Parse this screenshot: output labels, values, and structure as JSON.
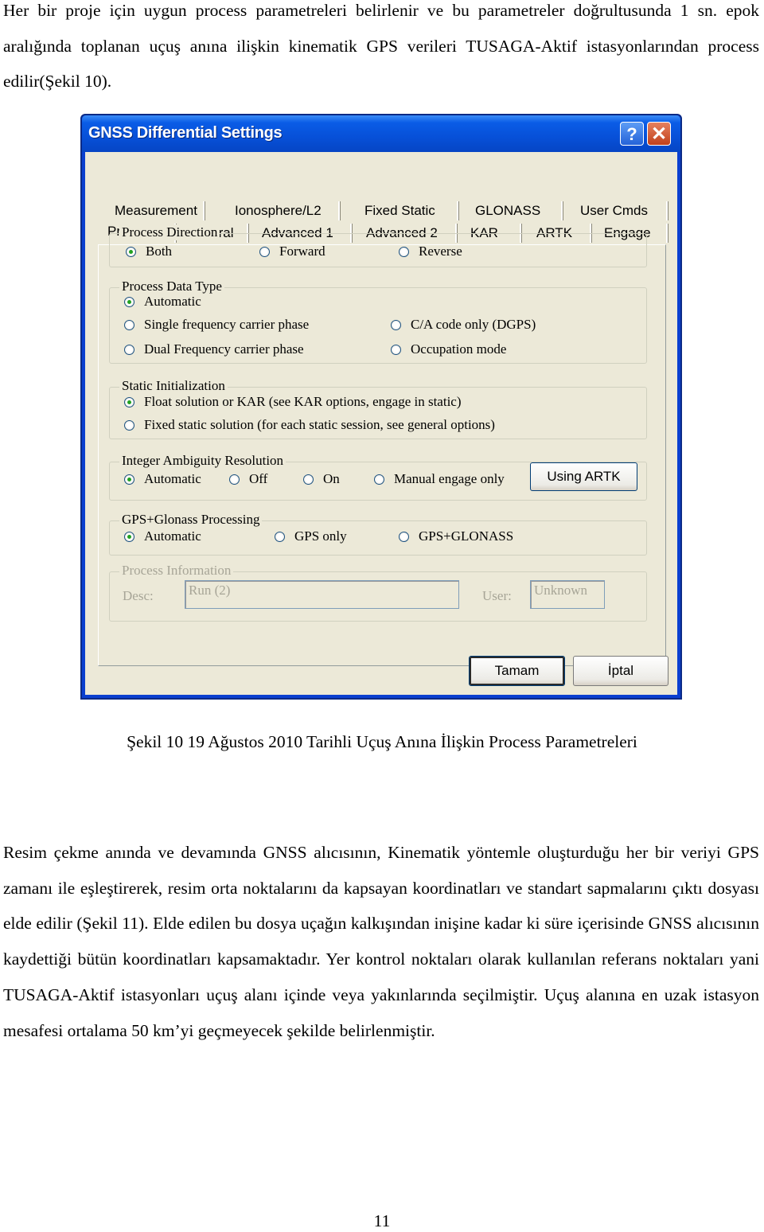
{
  "document": {
    "paragraph_1": "Her bir proje için uygun process parametreleri belirlenir ve bu parametreler doğrultusunda 1 sn. epok aralığında toplanan uçuş anına ilişkin kinematik GPS verileri TUSAGA-Aktif istasyonlarından process edilir(Şekil 10).",
    "caption": "Şekil 10 19 Ağustos 2010 Tarihli Uçuş Anına İlişkin Process Parametreleri",
    "paragraph_2": "Resim çekme anında ve devamında GNSS alıcısının, Kinematik yöntemle oluşturduğu her bir veriyi GPS zamanı ile eşleştirerek, resim orta noktalarını da kapsayan koordinatları ve standart sapmalarını çıktı dosyası elde edilir (Şekil 11). Elde edilen bu dosya uçağın kalkışından inişine kadar ki süre içerisinde GNSS alıcısının kaydettiği bütün koordinatları kapsamaktadır. Yer kontrol noktaları olarak kullanılan referans noktaları yani TUSAGA-Aktif istasyonları uçuş alanı içinde veya yakınlarında seçilmiştir. Uçuş alanına en uzak istasyon mesafesi ortalama 50 km’yi geçmeyecek şekilde belirlenmiştir.",
    "page_number": "11"
  },
  "dialog": {
    "title": "GNSS Differential Settings",
    "help_label": "?",
    "close_label": "✕",
    "tabs_row1": [
      "Measurement",
      "Ionosphere/L2",
      "Fixed Static",
      "GLONASS",
      "User Cmds"
    ],
    "tabs_row2": [
      "Process",
      "General",
      "Advanced 1",
      "Advanced 2",
      "KAR",
      "ARTK",
      "Engage"
    ],
    "active_tab": "Process",
    "groups": {
      "process_direction": {
        "title": "Process Direction",
        "options": [
          "Both",
          "Forward",
          "Reverse"
        ],
        "selected": "Both"
      },
      "process_data_type": {
        "title": "Process Data Type",
        "options": [
          "Automatic",
          "Single frequency carrier phase",
          "Dual Frequency carrier phase",
          "C/A code only (DGPS)",
          "Occupation mode"
        ],
        "selected": "Automatic"
      },
      "static_initialization": {
        "title": "Static Initialization",
        "options": [
          "Float solution or KAR (see KAR options, engage in static)",
          "Fixed static solution (for each static session, see general options)"
        ],
        "selected": "Float solution or KAR (see KAR options, engage in static)"
      },
      "integer_ambiguity": {
        "title": "Integer Ambiguity Resolution",
        "options": [
          "Automatic",
          "Off",
          "On",
          "Manual engage only"
        ],
        "selected": "Automatic",
        "button_label": "Using ARTK"
      },
      "gps_glonass": {
        "title": "GPS+Glonass Processing",
        "options": [
          "Automatic",
          "GPS only",
          "GPS+GLONASS"
        ],
        "selected": "Automatic"
      },
      "process_information": {
        "title": "Process Information",
        "desc_label": "Desc:",
        "desc_value": "Run (2)",
        "user_label": "User:",
        "user_value": "Unknown"
      }
    },
    "ok_label": "Tamam",
    "cancel_label": "İptal"
  }
}
